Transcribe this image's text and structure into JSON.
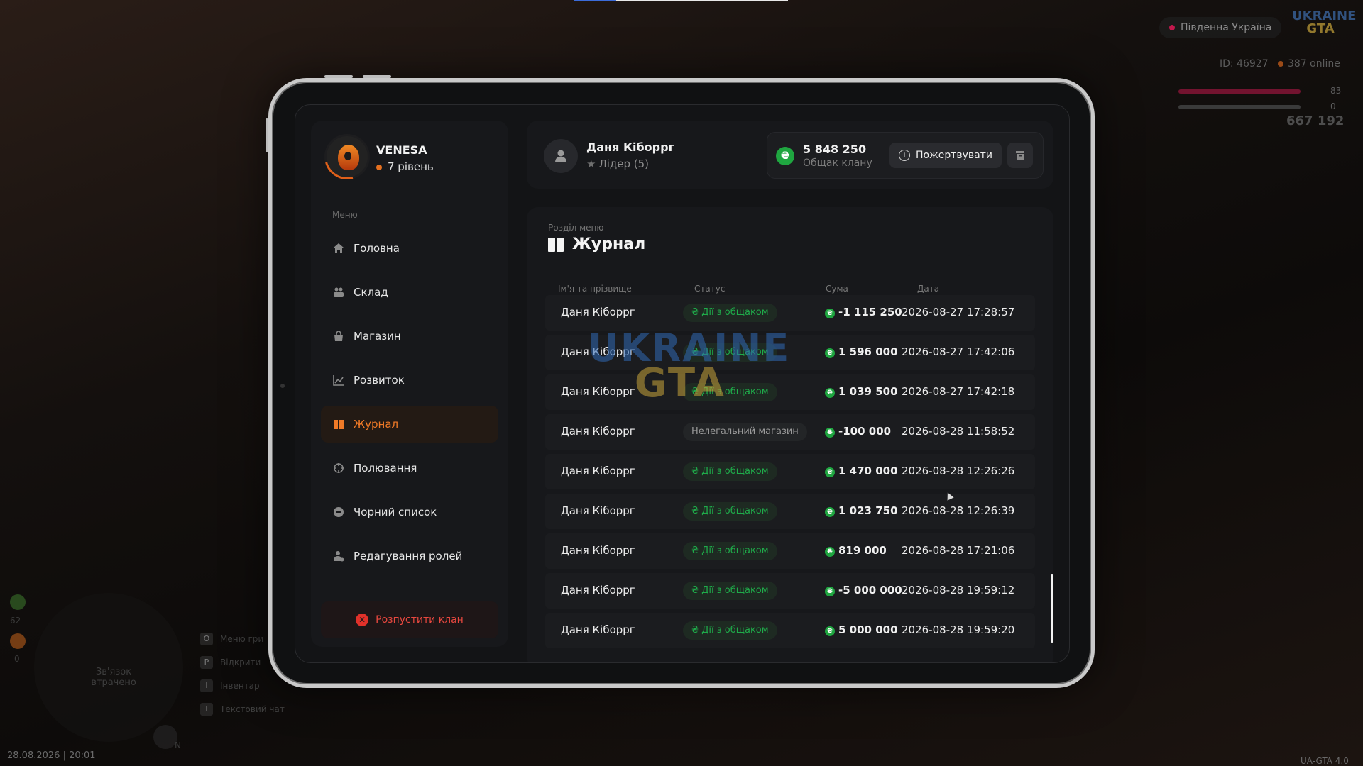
{
  "hud": {
    "region": "Південна Україна",
    "logo_top": "UKRAINE",
    "logo_bottom": "GTA",
    "player_id": "ID: 46927",
    "online": "387 online",
    "health_value": "83",
    "armor_value": "0",
    "money": "667 192",
    "connection_text": "Зв'язок втрачено",
    "status_value1": "62",
    "status_value2": "0",
    "mic_key": "N",
    "keys": [
      {
        "key": "O",
        "label": "Меню гри"
      },
      {
        "key": "P",
        "label": "Відкрити"
      },
      {
        "key": "I",
        "label": "Інвентар"
      },
      {
        "key": "T",
        "label": "Текстовий чат"
      }
    ],
    "clock": "28.08.2026 | 20:01",
    "version": "UA-GTA 4.0",
    "colors": {
      "health": "#c2184c",
      "armor": "#3a3a3a"
    }
  },
  "clan": {
    "name": "VENESA",
    "level": "7 рівень"
  },
  "menu": {
    "caption": "Меню",
    "items": [
      {
        "label": "Головна",
        "icon": "home-icon",
        "active": false
      },
      {
        "label": "Склад",
        "icon": "warehouse-icon",
        "active": false
      },
      {
        "label": "Магазин",
        "icon": "shop-icon",
        "active": false
      },
      {
        "label": "Розвиток",
        "icon": "chart-icon",
        "active": false
      },
      {
        "label": "Журнал",
        "icon": "journal-icon",
        "active": true
      },
      {
        "label": "Полювання",
        "icon": "crosshair-icon",
        "active": false
      },
      {
        "label": "Чорний список",
        "icon": "block-icon",
        "active": false
      },
      {
        "label": "Редагування ролей",
        "icon": "user-role-icon",
        "active": false
      }
    ],
    "disband_label": "Розпустити клан"
  },
  "user": {
    "name": "Даня Кіборрг",
    "role": "Лідер (5)"
  },
  "bank": {
    "amount": "5 848 250",
    "label": "Общак клану",
    "donate_label": "Пожертвувати"
  },
  "journal": {
    "caption": "Розділ меню",
    "title": "Журнал",
    "columns": [
      "Ім'я та прізвище",
      "Статус",
      "Сума",
      "Дата"
    ],
    "rows": [
      {
        "name": "Даня Кіборрг",
        "status": "Дії з общаком",
        "status_type": "green",
        "amount": "-1 115 250",
        "date": "2026-08-27 17:28:57"
      },
      {
        "name": "Даня Кіборрг",
        "status": "Дії з общаком",
        "status_type": "green",
        "amount": "1 596 000",
        "date": "2026-08-27 17:42:06"
      },
      {
        "name": "Даня Кіборрг",
        "status": "Дії з общаком",
        "status_type": "green",
        "amount": "1 039 500",
        "date": "2026-08-27 17:42:18"
      },
      {
        "name": "Даня Кіборрг",
        "status": "Нелегальний магазин",
        "status_type": "neutral",
        "amount": "-100 000",
        "date": "2026-08-28 11:58:52"
      },
      {
        "name": "Даня Кіборрг",
        "status": "Дії з общаком",
        "status_type": "green",
        "amount": "1 470 000",
        "date": "2026-08-28 12:26:26"
      },
      {
        "name": "Даня Кіборрг",
        "status": "Дії з общаком",
        "status_type": "green",
        "amount": "1 023 750",
        "date": "2026-08-28 12:26:39"
      },
      {
        "name": "Даня Кіборрг",
        "status": "Дії з общаком",
        "status_type": "green",
        "amount": "819 000",
        "date": "2026-08-28 17:21:06"
      },
      {
        "name": "Даня Кіборрг",
        "status": "Дії з общаком",
        "status_type": "green",
        "amount": "-5 000 000",
        "date": "2026-08-28 19:59:12"
      },
      {
        "name": "Даня Кіборрг",
        "status": "Дії з общаком",
        "status_type": "green",
        "amount": "5 000 000",
        "date": "2026-08-28 19:59:20"
      }
    ]
  },
  "watermark": {
    "top": "UKRAINE",
    "bottom": "GTA"
  },
  "colors": {
    "accent": "#f07a27",
    "money": "#1fa640",
    "danger": "#e0312a"
  }
}
